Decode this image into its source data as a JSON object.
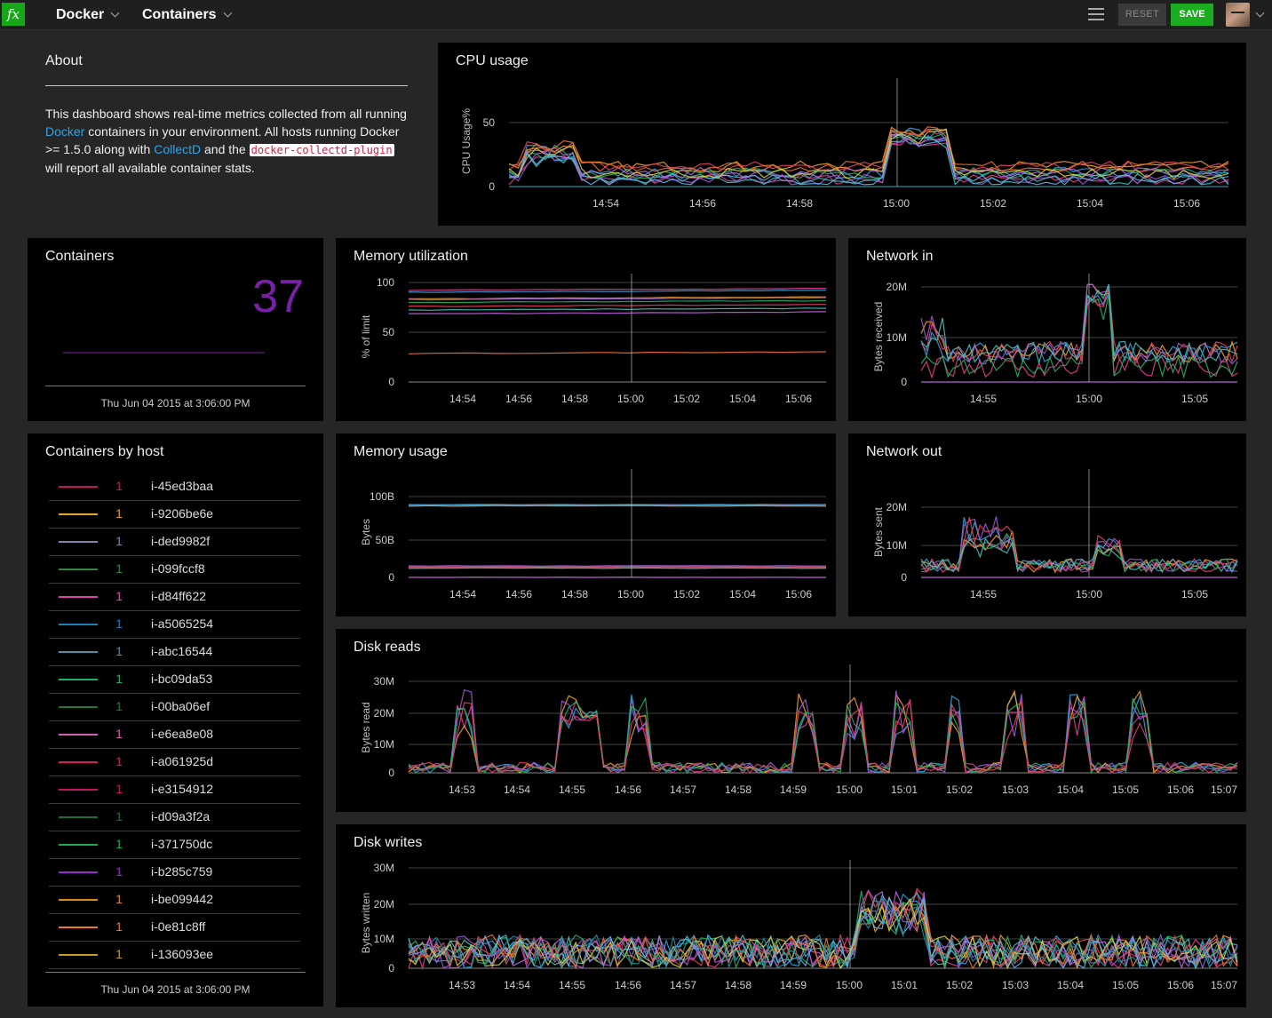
{
  "topbar": {
    "logo": "fx",
    "crumbs": [
      "Docker",
      "Containers"
    ],
    "reset_label": "RESET",
    "save_label": "SAVE"
  },
  "about": {
    "title": "About",
    "text_1": "This dashboard shows real-time metrics collected from all running ",
    "link_docker": "Docker",
    "text_2": " containers in your environment. All hosts running Docker >= 1.5.0 along with ",
    "link_collectd": "CollectD",
    "text_3": " and the ",
    "code": "docker-collectd-plugin",
    "text_4": " will report all available container stats."
  },
  "containers": {
    "title": "Containers",
    "value": "37",
    "value_color": "#7a1fa8",
    "timestamp": "Thu Jun 04 2015 at 3:06:00 PM"
  },
  "containers_by_host": {
    "title": "Containers by host",
    "timestamp": "Thu Jun 04 2015 at 3:06:00 PM",
    "hosts": [
      {
        "color": "#c2185b",
        "count": "1",
        "name": "i-45ed3baa"
      },
      {
        "color": "#e6a32d",
        "count": "1",
        "name": "i-9206be6e"
      },
      {
        "color": "#8a7fb0",
        "count": "1",
        "name": "i-ded9982f"
      },
      {
        "color": "#2e8b3a",
        "count": "1",
        "name": "i-099fccf8"
      },
      {
        "color": "#e040b0",
        "count": "1",
        "name": "i-d84ff622"
      },
      {
        "color": "#1e7fb8",
        "count": "1",
        "name": "i-a5065254"
      },
      {
        "color": "#4a90a8",
        "count": "1",
        "name": "i-abc16544"
      },
      {
        "color": "#1fae6e",
        "count": "1",
        "name": "i-bc09da53"
      },
      {
        "color": "#1d7a3a",
        "count": "1",
        "name": "i-00ba06ef"
      },
      {
        "color": "#d45fb0",
        "count": "1",
        "name": "i-e6ea8e08"
      },
      {
        "color": "#d81b60",
        "count": "1",
        "name": "i-a061925d"
      },
      {
        "color": "#c2185b",
        "count": "1",
        "name": "i-e3154912"
      },
      {
        "color": "#1b6e2e",
        "count": "1",
        "name": "i-d09a3f2a"
      },
      {
        "color": "#1faa55",
        "count": "1",
        "name": "i-371750dc"
      },
      {
        "color": "#9c27d0",
        "count": "1",
        "name": "i-b285c759"
      },
      {
        "color": "#d98a1a",
        "count": "1",
        "name": "i-be099442"
      },
      {
        "color": "#f07a1a",
        "count": "1",
        "name": "i-0e81c8ff"
      },
      {
        "color": "#c49a2a",
        "count": "1",
        "name": "i-136093ee"
      }
    ]
  },
  "charts": {
    "cpu": {
      "title": "CPU usage",
      "ylabel": "CPU Usage%",
      "yticks": [
        "0",
        "50"
      ],
      "xticks": [
        "14:54",
        "14:56",
        "14:58",
        "15:00",
        "15:02",
        "15:04",
        "15:06"
      ]
    },
    "mem_util": {
      "title": "Memory utilization",
      "ylabel": "% of limit",
      "yticks": [
        "0",
        "50",
        "100"
      ],
      "xticks": [
        "14:54",
        "14:56",
        "14:58",
        "15:00",
        "15:02",
        "15:04",
        "15:06"
      ]
    },
    "net_in": {
      "title": "Network in",
      "ylabel": "Bytes received",
      "yticks": [
        "0",
        "10M",
        "20M"
      ],
      "xticks": [
        "14:55",
        "15:00",
        "15:05"
      ]
    },
    "mem_usage": {
      "title": "Memory usage",
      "ylabel": "Bytes",
      "yticks": [
        "0",
        "50B",
        "100B"
      ],
      "xticks": [
        "14:54",
        "14:56",
        "14:58",
        "15:00",
        "15:02",
        "15:04",
        "15:06"
      ]
    },
    "net_out": {
      "title": "Network out",
      "ylabel": "Bytes sent",
      "yticks": [
        "0",
        "10M",
        "20M"
      ],
      "xticks": [
        "14:55",
        "15:00",
        "15:05"
      ]
    },
    "disk_reads": {
      "title": "Disk reads",
      "ylabel": "Bytes read",
      "yticks": [
        "0",
        "10M",
        "20M",
        "30M"
      ],
      "xticks": [
        "14:53",
        "14:54",
        "14:55",
        "14:56",
        "14:57",
        "14:58",
        "14:59",
        "15:00",
        "15:01",
        "15:02",
        "15:03",
        "15:04",
        "15:05",
        "15:06",
        "15:07"
      ]
    },
    "disk_writes": {
      "title": "Disk writes",
      "ylabel": "Bytes written",
      "yticks": [
        "0",
        "10M",
        "20M",
        "30M"
      ],
      "xticks": [
        "14:53",
        "14:54",
        "14:55",
        "14:56",
        "14:57",
        "14:58",
        "14:59",
        "15:00",
        "15:01",
        "15:02",
        "15:03",
        "15:04",
        "15:05",
        "15:06",
        "15:07"
      ]
    }
  },
  "palette": [
    "#e8388a",
    "#2aa5e0",
    "#f0a020",
    "#9b59d0",
    "#20b060",
    "#e04060",
    "#40c0c0",
    "#c060e0",
    "#f07030",
    "#60b0f0",
    "#d0d040",
    "#1f8fa0"
  ]
}
